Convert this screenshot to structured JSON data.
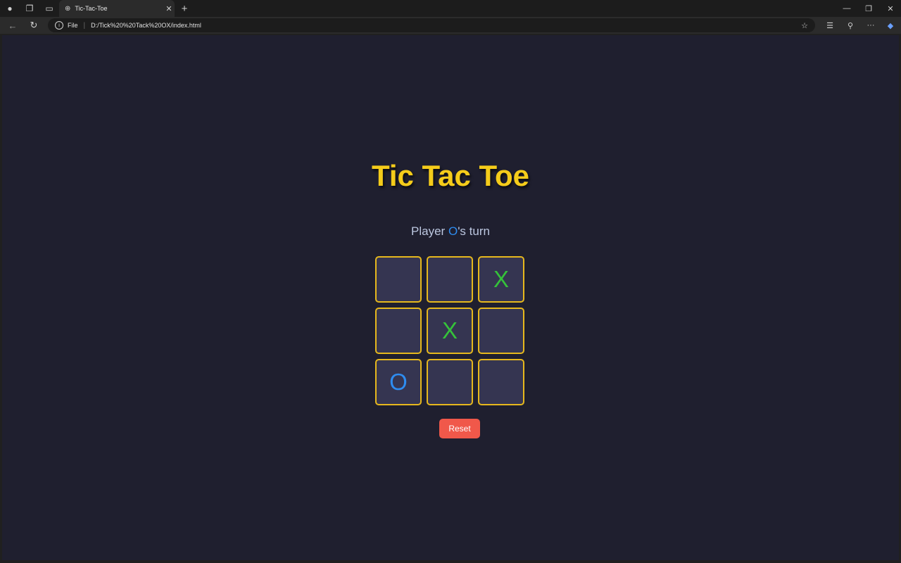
{
  "browser": {
    "tab_title": "Tic-Tac-Toe",
    "url_scheme": "File",
    "url": "D:/Tick%20%20Tack%20OX/index.html"
  },
  "game": {
    "title": "Tic Tac Toe",
    "status_prefix": "Player ",
    "current_player": "O",
    "status_suffix": "'s turn",
    "board": [
      "",
      "",
      "X",
      "",
      "X",
      "",
      "O",
      "",
      ""
    ],
    "reset_label": "Reset"
  },
  "colors": {
    "title": "#f5cc1a",
    "x_mark": "#35c23a",
    "o_mark": "#2e8cf0",
    "cell_border": "#e6b81d",
    "reset_button": "#f0584a",
    "page_background": "#1f1f2f"
  }
}
